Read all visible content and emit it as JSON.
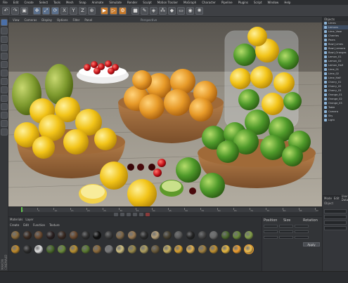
{
  "menubar": {
    "items": [
      "File",
      "Edit",
      "Create",
      "Select",
      "Tools",
      "Mesh",
      "Snap",
      "Animate",
      "Simulate",
      "Render",
      "Sculpt",
      "Motion Tracker",
      "MoGraph",
      "Character",
      "Pipeline",
      "Plugins",
      "Script",
      "Window",
      "Help"
    ]
  },
  "toolbar": {
    "icons": [
      "undo-icon",
      "redo-icon",
      "select-icon",
      "move-icon",
      "scale-icon",
      "rotate-icon",
      "x-axis-icon",
      "y-axis-icon",
      "z-axis-icon",
      "coord-icon",
      "render-view-icon",
      "render-pv-icon",
      "render-settings-icon",
      "cube-icon",
      "pen-icon",
      "subdivide-icon",
      "array-icon",
      "deformer-icon",
      "floor-icon",
      "camera-icon",
      "light-icon"
    ]
  },
  "viewport": {
    "menu": [
      "View",
      "Cameras",
      "Display",
      "Options",
      "Filter",
      "Panel"
    ],
    "title": "Perspective"
  },
  "object_manager": {
    "tabs": [
      "File",
      "Edit",
      "View",
      "Objects",
      "Tags",
      "Bookmarks"
    ],
    "items": [
      "Limes",
      "Lemons",
      "Lime_Vase",
      "Cherries",
      "Pears",
      "Bowl_Limes",
      "Bowl_Lemons",
      "Bowl_Oranges",
      "Lemon_01",
      "Lemon_02",
      "Lemon_Half",
      "Lime_01",
      "Lime_02",
      "Lime_Half",
      "Cherry_01",
      "Cherry_02",
      "Cherry_03",
      "Orange_01",
      "Orange_02",
      "Orange_03",
      "Table",
      "Camera",
      "Sky",
      "Light"
    ],
    "selected_index": 1
  },
  "attribute_manager": {
    "tabs": [
      "Mode",
      "Edit",
      "User Data"
    ],
    "section": "Object"
  },
  "timeline": {
    "ticks": [
      "0",
      "5",
      "10",
      "15",
      "20",
      "25",
      "30",
      "35",
      "40",
      "45",
      "50",
      "55",
      "60",
      "65",
      "70",
      "75",
      "80",
      "85",
      "90"
    ],
    "current_frame": 0
  },
  "material_manager": {
    "tabs": [
      "Materials",
      "Layer"
    ],
    "menu": [
      "Create",
      "Edit",
      "Function",
      "Texture"
    ],
    "materials": [
      [
        "#8a6a3a",
        "#3b2a20",
        "#6a4a30",
        "#2a2020",
        "#3a2a22",
        "#6d4a2e",
        "#2f2f2f",
        "#101010",
        "#3a3a3a",
        "#7f6848",
        "#9a7a52",
        "#2b2b2b",
        "#b7a17a",
        "#47402f",
        "#5a5a5a",
        "#252525",
        "#444444",
        "#6a6a6a",
        "#4c6a2e",
        "#6a8a3a",
        "#85a04a"
      ],
      [
        "#c08a2a",
        "#2a2a2a",
        "#e0e0e0",
        "#4a6a2a",
        "#6a8a3a",
        "#b89030",
        "#5a7a30",
        "#8c6a3a",
        "#7a7a7a",
        "#d0c080",
        "#9a8a4a",
        "#b0a060",
        "#6a5a3a",
        "#c8b060",
        "#d8a030",
        "#e0b050",
        "#a08040",
        "#c09030",
        "#e8b840",
        "#f0a030",
        "#f2c050"
      ]
    ],
    "selected": [
      1,
      20
    ]
  },
  "coordinates": {
    "headers": [
      "Position",
      "Size",
      "Rotation"
    ],
    "apply_label": "Apply"
  },
  "side_logo": "MAXON CINEMA4D"
}
